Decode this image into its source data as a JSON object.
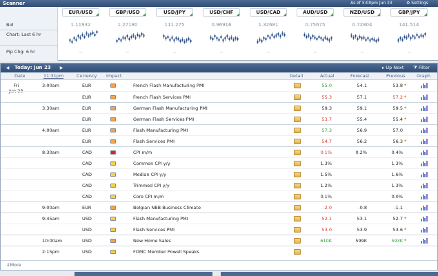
{
  "scanner": {
    "title": "Scanner",
    "as_of": "As of 5:00pm Jun 23",
    "settings": "⚙ Settings",
    "labels": {
      "bid": "Bid",
      "chart": "Chart: Last 6 hr",
      "pip": "Pip Chg: 6 hr"
    },
    "pairs": [
      {
        "name": "EUR/USD",
        "bid": "1.11932",
        "chg": "--"
      },
      {
        "name": "GBP/USD",
        "bid": "1.27180",
        "chg": "--"
      },
      {
        "name": "USD/JPY",
        "bid": "111.275",
        "chg": "--"
      },
      {
        "name": "USD/CHF",
        "bid": "0.96916",
        "chg": "--"
      },
      {
        "name": "USD/CAD",
        "bid": "1.32681",
        "chg": "--"
      },
      {
        "name": "AUD/USD",
        "bid": "0.75675",
        "chg": "--"
      },
      {
        "name": "NZD/USD",
        "bid": "0.72804",
        "chg": "--"
      },
      {
        "name": "GBP/JPY",
        "bid": "141.514",
        "chg": "--"
      }
    ]
  },
  "calendar": {
    "today": "Today: Jun 23",
    "up_next": "▸ Up Next",
    "filter": "⧩ Filter",
    "columns": {
      "date": "Date",
      "time": "11:31pm",
      "currency": "Currency",
      "impact": "Impact",
      "detail": "Detail",
      "actual": "Actual",
      "forecast": "Forecast",
      "previous": "Previous",
      "graph": "Graph"
    },
    "date_day": "Fri",
    "date_value": "Jun 23",
    "rows": [
      {
        "time": "3:00am",
        "currency": "EUR",
        "event": "French Flash Manufacturing PMI",
        "actual": "55.0",
        "forecast": "54.1",
        "previous": "53.8"
      },
      {
        "time": "",
        "currency": "EUR",
        "event": "French Flash Services PMI",
        "actual": "55.3",
        "forecast": "57.1",
        "previous": "57.2"
      },
      {
        "time": "3:30am",
        "currency": "EUR",
        "event": "German Flash Manufacturing PMI",
        "actual": "59.3",
        "forecast": "59.1",
        "previous": "59.5"
      },
      {
        "time": "",
        "currency": "EUR",
        "event": "German Flash Services PMI",
        "actual": "53.7",
        "forecast": "55.4",
        "previous": "55.4"
      },
      {
        "time": "4:00am",
        "currency": "EUR",
        "event": "Flash Manufacturing PMI",
        "actual": "57.3",
        "forecast": "56.9",
        "previous": "57.0"
      },
      {
        "time": "",
        "currency": "EUR",
        "event": "Flash Services PMI",
        "actual": "54.7",
        "forecast": "56.2",
        "previous": "56.3"
      },
      {
        "time": "8:30am",
        "currency": "CAD",
        "event": "CPI m/m",
        "actual": "0.1%",
        "forecast": "0.2%",
        "previous": "0.4%"
      },
      {
        "time": "",
        "currency": "CAD",
        "event": "Common CPI y/y",
        "actual": "1.3%",
        "forecast": "",
        "previous": "1.3%"
      },
      {
        "time": "",
        "currency": "CAD",
        "event": "Median CPI y/y",
        "actual": "1.5%",
        "forecast": "",
        "previous": "1.6%"
      },
      {
        "time": "",
        "currency": "CAD",
        "event": "Trimmed CPI y/y",
        "actual": "1.2%",
        "forecast": "",
        "previous": "1.3%"
      },
      {
        "time": "",
        "currency": "CAD",
        "event": "Core CPI m/m",
        "actual": "0.1%",
        "forecast": "",
        "previous": "0.0%"
      },
      {
        "time": "9:00am",
        "currency": "EUR",
        "event": "Belgian NBB Business Climate",
        "actual": "-2.0",
        "forecast": "-0.8",
        "previous": "-1.1"
      },
      {
        "time": "9:45am",
        "currency": "USD",
        "event": "Flash Manufacturing PMI",
        "actual": "52.1",
        "forecast": "53.1",
        "previous": "52.7"
      },
      {
        "time": "",
        "currency": "USD",
        "event": "Flash Services PMI",
        "actual": "53.0",
        "forecast": "53.9",
        "previous": "53.6"
      },
      {
        "time": "10:00am",
        "currency": "USD",
        "event": "New Home Sales",
        "actual": "610K",
        "forecast": "599K",
        "previous": "593K"
      },
      {
        "time": "2:15pm",
        "currency": "USD",
        "event": "FOMC Member Powell Speaks",
        "actual": "",
        "forecast": "",
        "previous": ""
      }
    ],
    "more": "⇓More"
  }
}
